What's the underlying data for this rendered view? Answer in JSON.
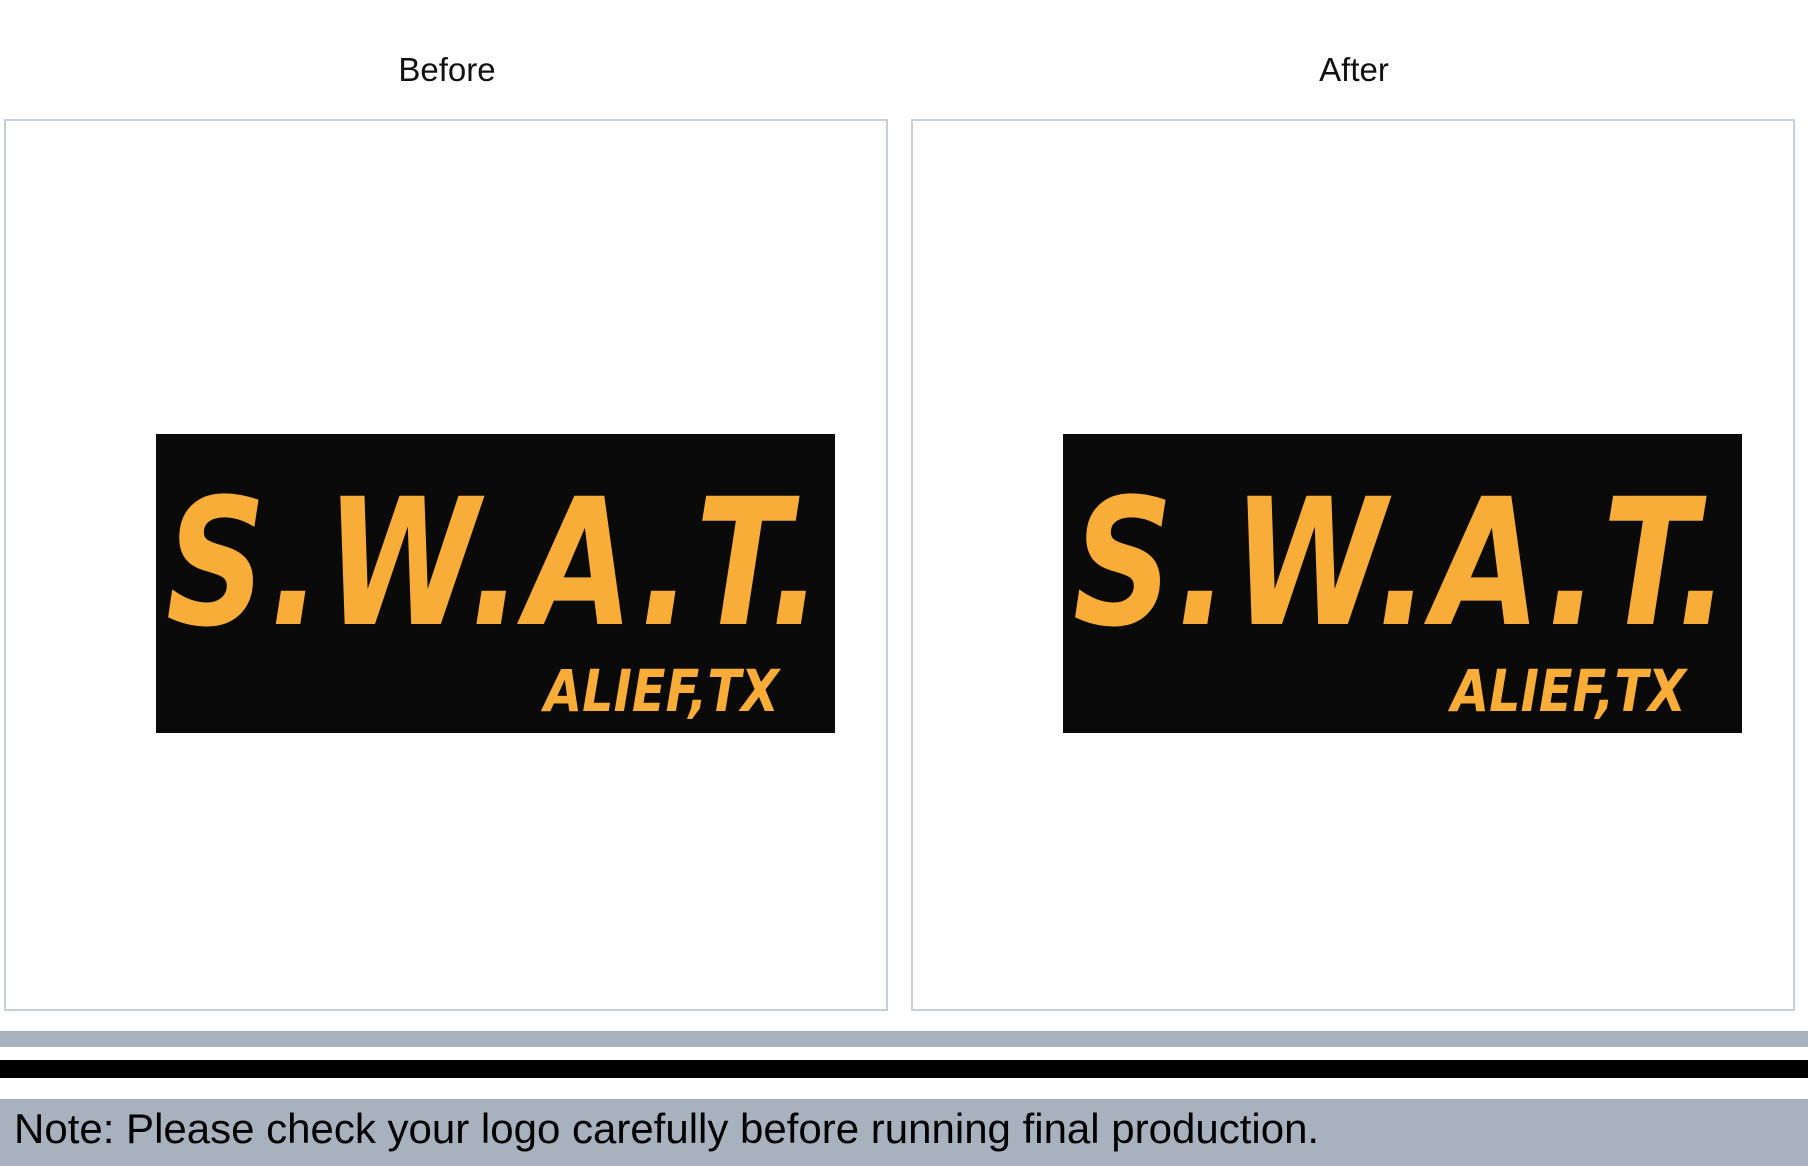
{
  "labels": {
    "before": "Before",
    "after": "After"
  },
  "logo": {
    "title": "S.W.A.T.",
    "subtitle": "ALIEF,TX",
    "text_color": "#f7ad37",
    "background_color": "#0a0a0a"
  },
  "note": {
    "text": "Note: Please check your logo carefully before running final production."
  },
  "colors": {
    "panel_border": "#c9cfd8",
    "bar_gray": "#a8b2bf",
    "bar_black": "#000000"
  }
}
